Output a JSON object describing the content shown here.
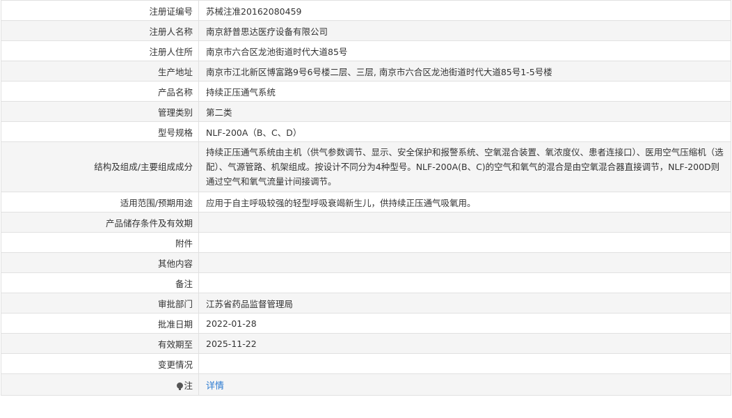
{
  "rows": [
    {
      "label": "注册证编号",
      "value": "苏械注准20162080459"
    },
    {
      "label": "注册人名称",
      "value": "南京舒普思达医疗设备有限公司"
    },
    {
      "label": "注册人住所",
      "value": "南京市六合区龙池街道时代大道85号"
    },
    {
      "label": "生产地址",
      "value": "南京市江北新区博富路9号6号楼二层、三层, 南京市六合区龙池街道时代大道85号1-5号楼"
    },
    {
      "label": "产品名称",
      "value": "持续正压通气系统"
    },
    {
      "label": "管理类别",
      "value": "第二类"
    },
    {
      "label": "型号规格",
      "value": "NLF-200A（B、C、D）"
    },
    {
      "label": "结构及组成/主要组成成分",
      "value": "持续正压通气系统由主机（供气参数调节、显示、安全保护和报警系统、空氧混合装置、氧浓度仪、患者连接口）、医用空气压缩机（选配）、气源管路、机架组成。按设计不同分为4种型号。NLF-200A(B、C)的空气和氧气的混合是由空氧混合器直接调节，NLF-200D则通过空气和氧气流量计间接调节。"
    },
    {
      "label": "适用范围/预期用途",
      "value": "应用于自主呼吸较强的轻型呼吸衰竭新生儿，供持续正压通气吸氧用。"
    },
    {
      "label": "产品储存条件及有效期",
      "value": ""
    },
    {
      "label": "附件",
      "value": ""
    },
    {
      "label": "其他内容",
      "value": ""
    },
    {
      "label": "备注",
      "value": ""
    },
    {
      "label": "审批部门",
      "value": "江苏省药品监督管理局"
    },
    {
      "label": "批准日期",
      "value": "2022-01-28"
    },
    {
      "label": "有效期至",
      "value": "2025-11-22"
    },
    {
      "label": "变更情况",
      "value": ""
    }
  ],
  "note": {
    "label": "注",
    "icon": "lightbulb-icon",
    "link_text": "详情"
  }
}
